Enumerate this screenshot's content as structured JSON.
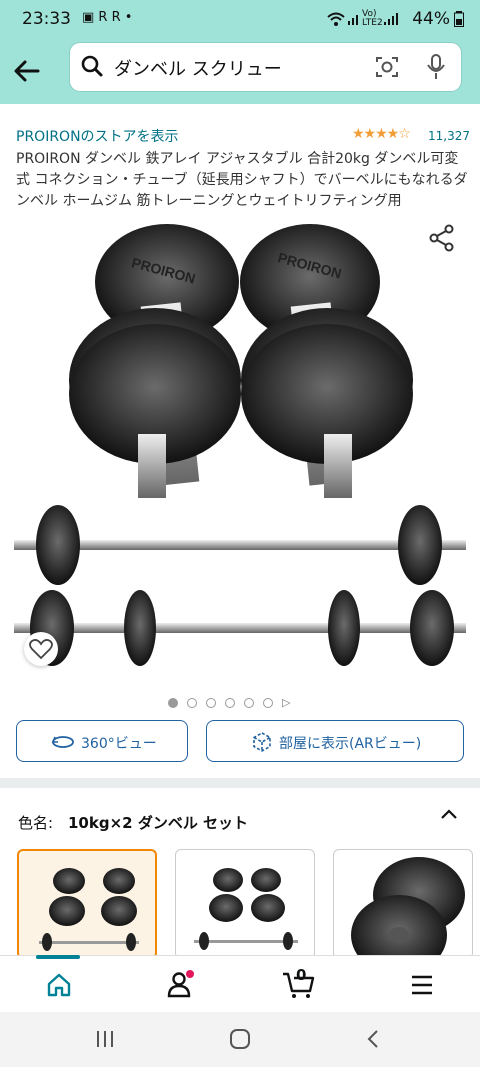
{
  "status_bar": {
    "time": "23:33",
    "notif_icons": "▣ R R •",
    "network": "Vo) LTE2",
    "battery": "44%"
  },
  "search": {
    "query": "ダンベル スクリュー"
  },
  "product": {
    "store_link": "PROIRONのストアを表示",
    "rating_stars": "★★★★☆",
    "rating": 4.3,
    "review_count": "11,327",
    "title": "PROIRON ダンベル 鉄アレイ アジャスタブル 合計20kg ダンベル可変式 コネクション・チューブ（延長用シャフト）でバーベルにもなれるダンベル ホームジム 筋トレーニングとウェイトリフティング用",
    "image_count": 6,
    "active_image": 1,
    "plate_text": "PROIRON"
  },
  "buttons": {
    "view360": "360°ビュー",
    "ar_view": "部屋に表示(ARビュー)"
  },
  "variant": {
    "label": "色名:",
    "value": "10kg×2 ダンベル セット"
  },
  "nav": {
    "cart_count": "0"
  },
  "colors": {
    "accent": "#9fe2d7",
    "link": "#007185",
    "button": "#2162a1",
    "star": "#f19e38",
    "nav_active": "#008296",
    "badge": "#e3165b"
  }
}
